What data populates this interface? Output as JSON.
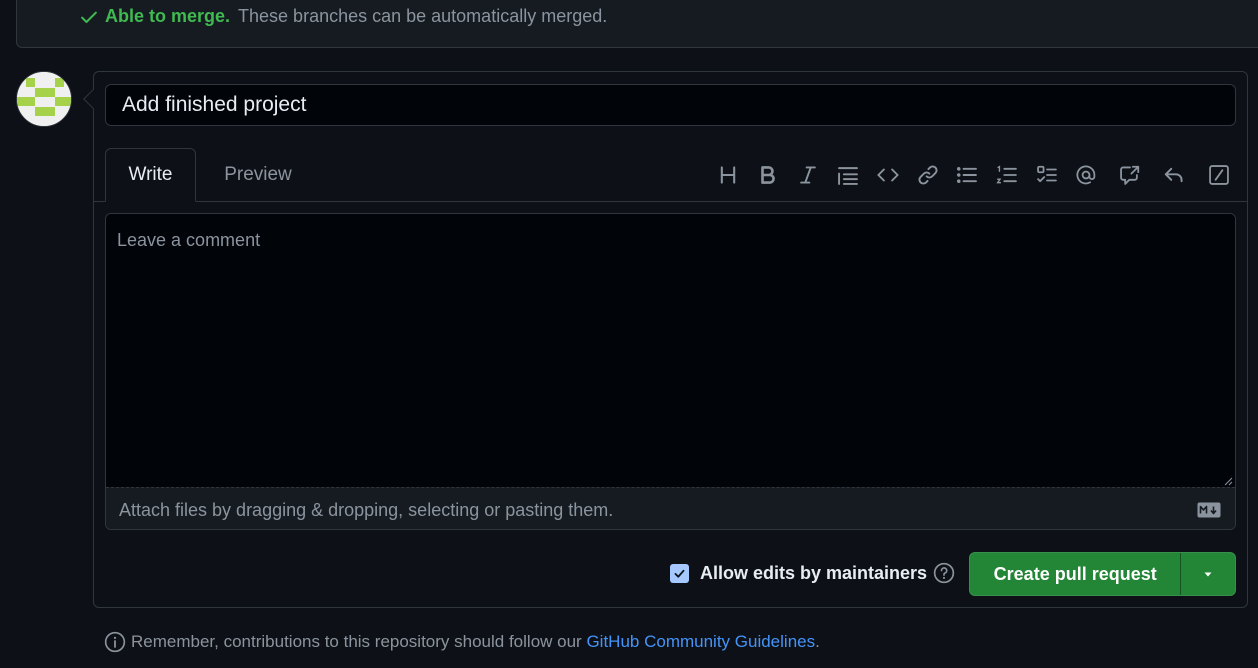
{
  "merge_status": {
    "strong": "Able to merge.",
    "detail": "These branches can be automatically merged."
  },
  "pr_form": {
    "title_value": "Add finished project",
    "tabs": [
      {
        "label": "Write",
        "active": true
      },
      {
        "label": "Preview",
        "active": false
      }
    ],
    "toolbar": [
      {
        "icon": "heading-icon"
      },
      {
        "icon": "bold-icon"
      },
      {
        "icon": "italic-icon"
      },
      {
        "icon": "quote-icon"
      },
      {
        "icon": "code-icon"
      },
      {
        "icon": "link-icon"
      },
      {
        "icon": "unordered-list-icon"
      },
      {
        "icon": "ordered-list-icon"
      },
      {
        "icon": "task-list-icon"
      },
      {
        "icon": "mention-icon"
      },
      {
        "icon": "cross-reference-icon"
      },
      {
        "icon": "reply-icon"
      },
      {
        "icon": "slash-command-icon"
      }
    ],
    "comment_placeholder": "Leave a comment",
    "attach_text": "Attach files by dragging & dropping, selecting or pasting them.",
    "allow_edits_label": "Allow edits by maintainers",
    "allow_edits_checked": true,
    "create_button": "Create pull request"
  },
  "footer": {
    "prefix": "Remember, contributions to this repository should follow our ",
    "link": "GitHub Community Guidelines",
    "suffix": "."
  },
  "colors": {
    "background": "#0d1117",
    "success": "#3fb950",
    "primary_button": "#238636",
    "link": "#4493f8",
    "avatar_pattern": "#a6d14a"
  }
}
